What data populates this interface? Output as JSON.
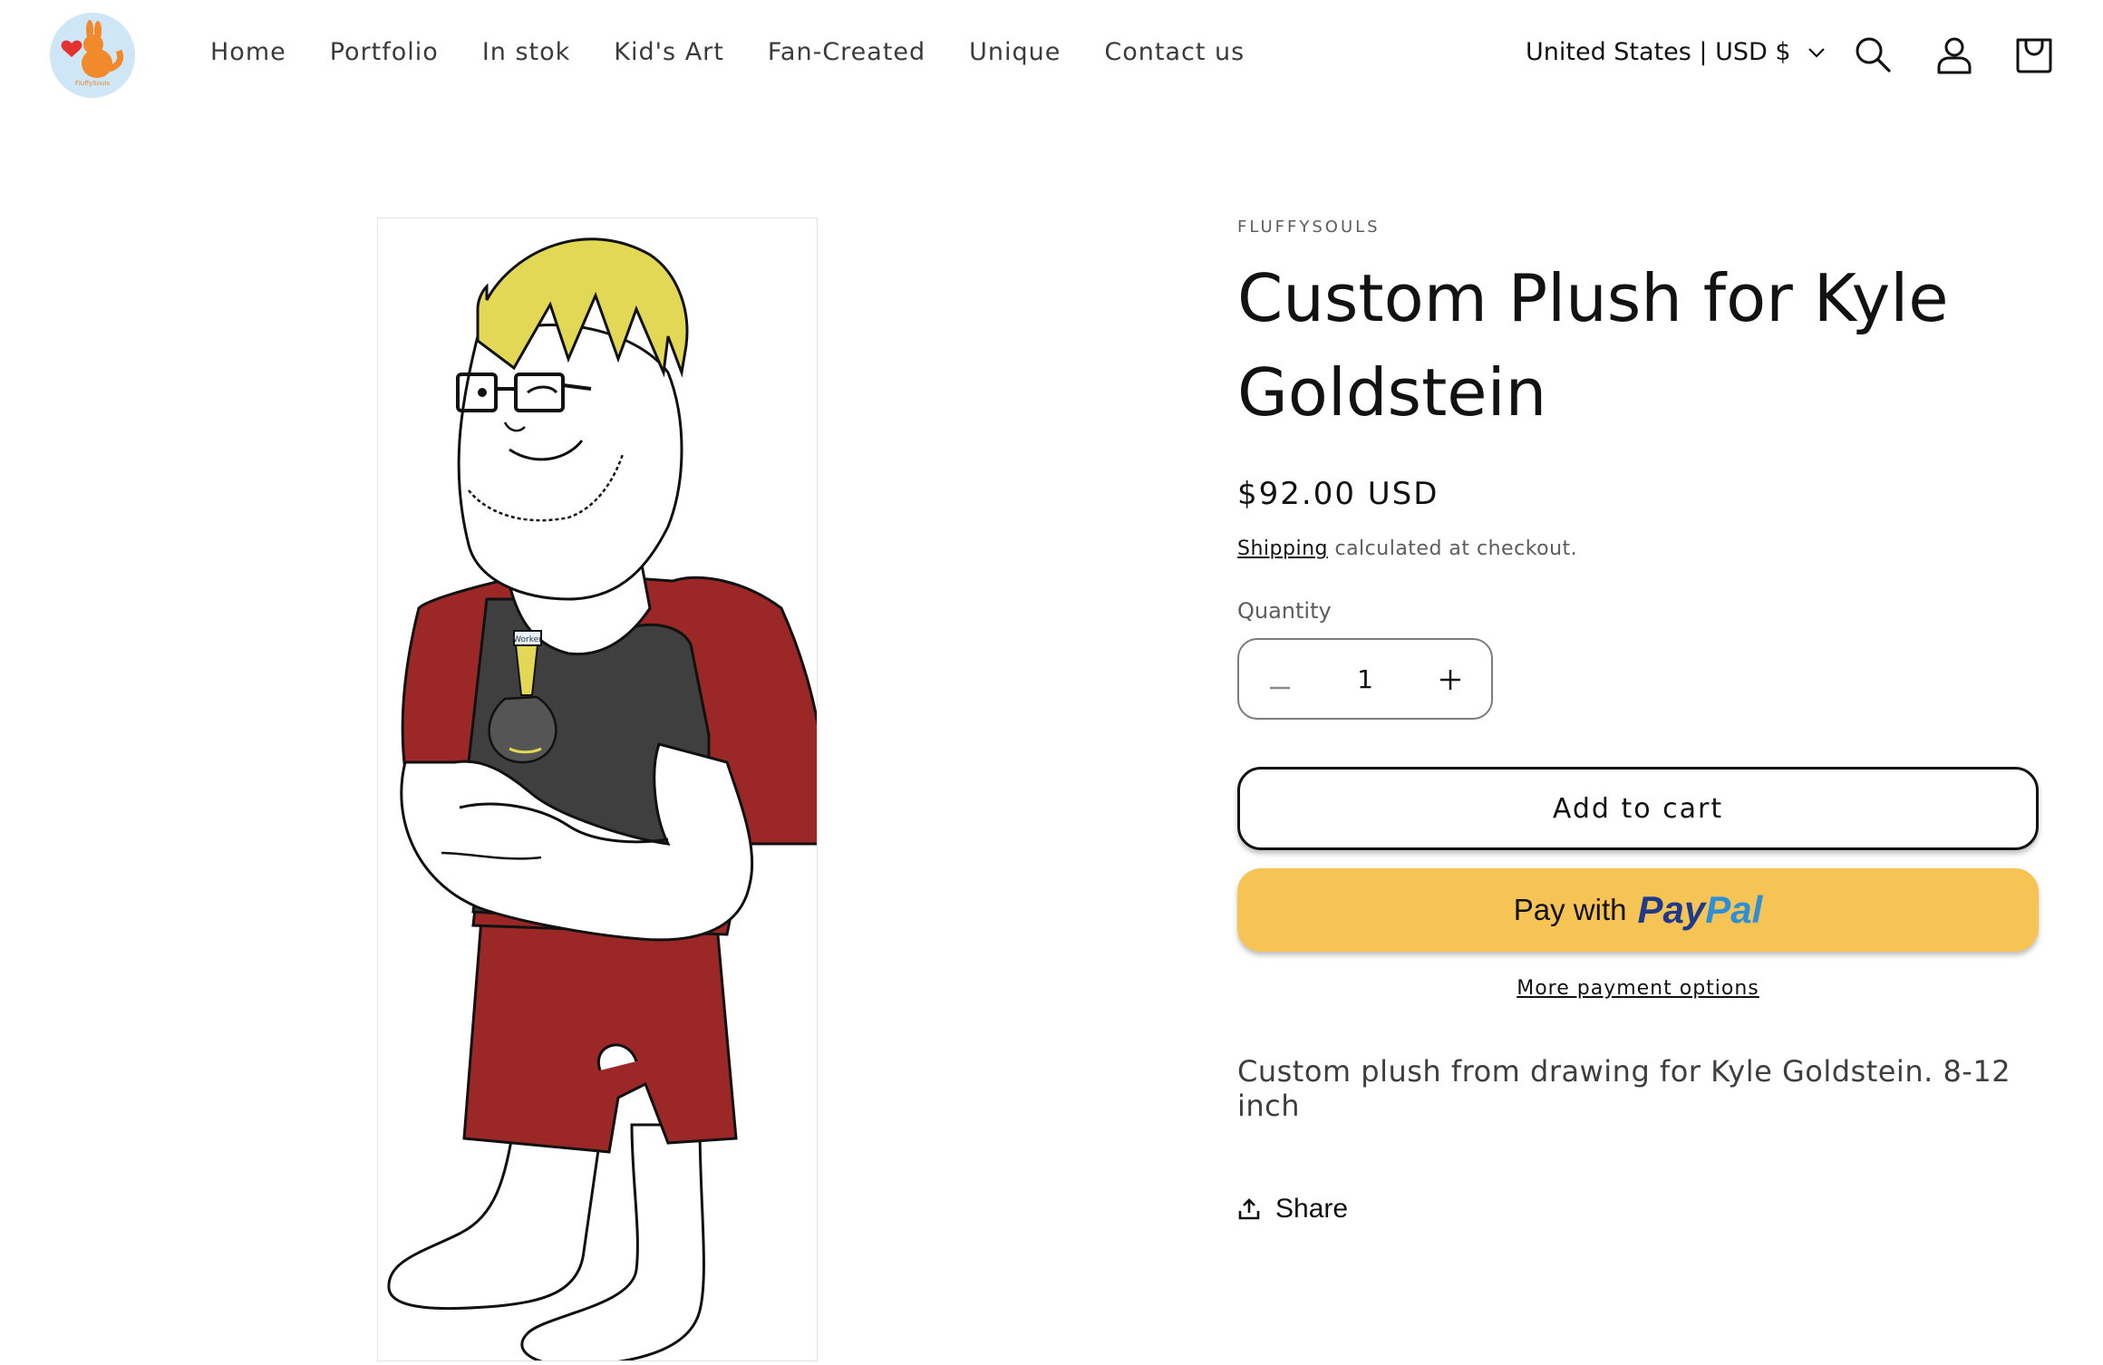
{
  "header": {
    "logo_text": "FluffySouls",
    "nav": [
      "Home",
      "Portfolio",
      "In stok",
      "Kid's Art",
      "Fan-Created",
      "Unique",
      "Contact us"
    ],
    "locale": "United States | USD $",
    "icons": [
      "search-icon",
      "account-icon",
      "cart-icon"
    ]
  },
  "product": {
    "vendor": "FLUFFYSOULS",
    "title": "Custom Plush for Kyle Goldstein",
    "price": "$92.00 USD",
    "shipping_link": "Shipping",
    "shipping_text": " calculated at checkout.",
    "quantity_label": "Quantity",
    "quantity_value": "1",
    "add_to_cart": "Add to cart",
    "paypal_prefix": "Pay with",
    "paypal_brand_1": "Pay",
    "paypal_brand_2": "Pal",
    "more_payment": "More payment options",
    "description": "Custom plush from drawing for Kyle Goldstein. 8-12 inch",
    "share": "Share",
    "badge_text": "Worker"
  },
  "colors": {
    "paypal_yellow": "#f6c454",
    "paypal_dark_blue": "#1f3a8a",
    "paypal_light_blue": "#2d8fd5",
    "shirt_red": "#9b2727",
    "shirt_dark": "#3f3f3f",
    "hair_yellow": "#e3d756"
  }
}
